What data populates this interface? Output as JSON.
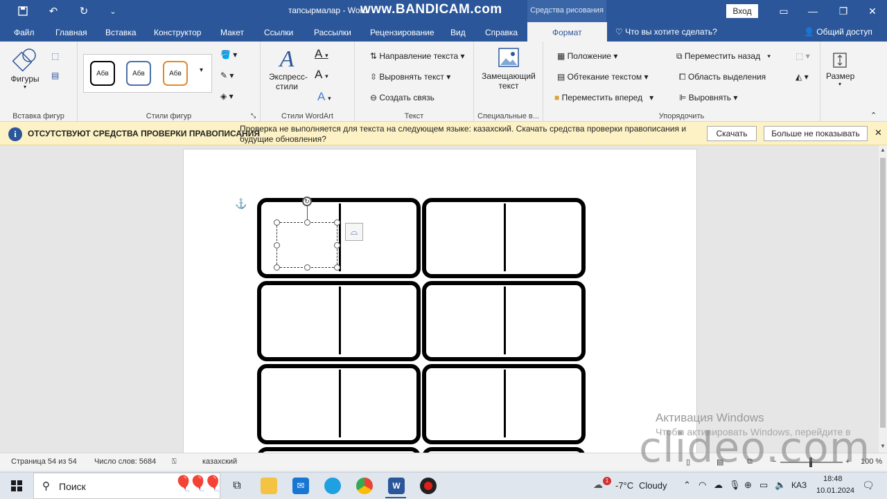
{
  "titlebar": {
    "doc_title": "тапсырмалар - Word",
    "bandicam": "www.BANDICAM.com",
    "drawing_tools": "Средства рисования",
    "login": "Вход",
    "qa_save_icon": "save-icon",
    "qa_undo_icon": "undo-icon",
    "qa_redo_icon": "redo-icon"
  },
  "tabs": {
    "file": "Файл",
    "home": "Главная",
    "insert": "Вставка",
    "design": "Конструктор",
    "layout": "Макет",
    "references": "Ссылки",
    "mailings": "Рассылки",
    "review": "Рецензирование",
    "view": "Вид",
    "help": "Справка",
    "format": "Формат",
    "tellme": "Что вы хотите сделать?",
    "share": "Общий доступ"
  },
  "ribbon": {
    "shapes": "Фигуры",
    "insert_shapes_label": "Вставка фигур",
    "style_thumb": "Абв",
    "shape_styles_label": "Стили фигур",
    "express_styles_1": "Экспресс-",
    "express_styles_2": "стили",
    "wordart_label": "Стили WordArt",
    "text_direction": "Направление текста",
    "align_text": "Выровнять текст",
    "create_link": "Создать связь",
    "text_label": "Текст",
    "alt_text_1": "Замещающий",
    "alt_text_2": "текст",
    "special_label": "Специальные в...",
    "position": "Положение",
    "wrap_text": "Обтекание текстом",
    "bring_forward": "Переместить вперед",
    "send_backward": "Переместить назад",
    "selection_pane": "Область выделения",
    "align": "Выровнять",
    "arrange_label": "Упорядочить",
    "size": "Размер"
  },
  "message_bar": {
    "title": "ОТСУТСТВУЮТ СРЕДСТВА ПРОВЕРКИ ПРАВОПИСАНИЯ",
    "text": "Проверка не выполняется для текста на следующем языке: казахский. Скачать средства проверки правописания и будущие обновления?",
    "download": "Скачать",
    "dont_show": "Больше не показывать"
  },
  "status": {
    "page": "Страница 54 из 54",
    "words": "Число слов: 5684",
    "language": "казахский",
    "zoom": "100 %"
  },
  "watermarks": {
    "activation": "Активация Windows",
    "activation_sub": "Чтобы активировать Windows, перейдите в",
    "clideo": "clideo.com"
  },
  "taskbar": {
    "search": "Поиск",
    "temperature": "-7°C",
    "weather": "Cloudy",
    "weather_badge": "1",
    "lang": "КАЗ",
    "time": "18:48",
    "date": "10.01.2024"
  }
}
